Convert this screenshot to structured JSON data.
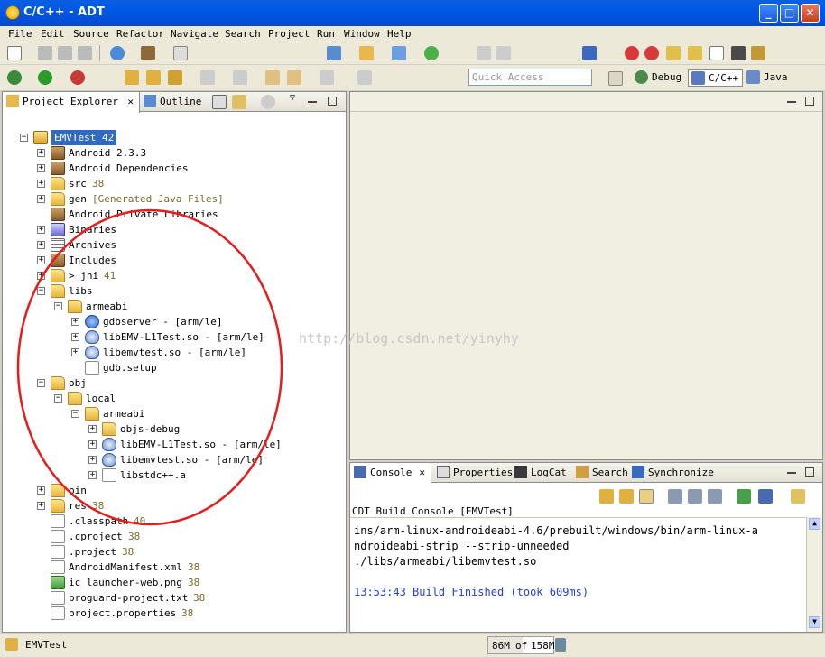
{
  "window": {
    "title": "C/C++ - ADT",
    "minimize": "_",
    "maximize": "□",
    "close": "✕"
  },
  "menu": [
    "File",
    "Edit",
    "Source",
    "Refactor",
    "Navigate",
    "Search",
    "Project",
    "Run",
    "Window",
    "Help"
  ],
  "quick_access": {
    "placeholder": "Quick Access"
  },
  "perspectives": [
    {
      "label": "Debug"
    },
    {
      "label": "C/C++",
      "active": true
    },
    {
      "label": "Java"
    }
  ],
  "left_panel": {
    "tabs": [
      {
        "label": "Project Explorer",
        "close": "✕"
      },
      {
        "label": "Outline"
      }
    ],
    "tree": [
      {
        "label": "EMVTest 42",
        "selected": true,
        "icon": "project-icon",
        "depth": 0,
        "expander": "minus"
      },
      {
        "label": "Android 2.3.3",
        "icon": "library-icon",
        "depth": 1,
        "expander": "plus"
      },
      {
        "label": "Android Dependencies",
        "icon": "library-icon",
        "depth": 1,
        "expander": "plus"
      },
      {
        "label": "src",
        "decoration": "38",
        "icon": "source-folder-icon",
        "depth": 1,
        "expander": "plus"
      },
      {
        "label": "gen",
        "decoration": "[Generated Java Files]",
        "icon": "source-folder-icon",
        "depth": 1,
        "expander": "plus"
      },
      {
        "label": "Android Private Libraries",
        "icon": "library-icon",
        "depth": 1,
        "expander": "none"
      },
      {
        "label": "Binaries",
        "icon": "binaries-icon",
        "depth": 1,
        "expander": "plus"
      },
      {
        "label": "Archives",
        "icon": "archives-icon",
        "depth": 1,
        "expander": "plus"
      },
      {
        "label": "Includes",
        "icon": "includes-icon",
        "depth": 1,
        "expander": "plus"
      },
      {
        "label": "> jni",
        "decoration": "41",
        "icon": "folder-icon",
        "depth": 1,
        "expander": "plus"
      },
      {
        "label": "libs",
        "icon": "folder-icon",
        "depth": 1,
        "expander": "minus"
      },
      {
        "label": "armeabi",
        "icon": "folder-icon",
        "depth": 2,
        "expander": "minus"
      },
      {
        "label": "gdbserver - [arm/le]",
        "icon": "executable-icon",
        "depth": 3,
        "expander": "plus"
      },
      {
        "label": "libEMV-L1Test.so - [arm/le]",
        "icon": "shared-object-icon",
        "depth": 3,
        "expander": "plus"
      },
      {
        "label": "libemvtest.so - [arm/le]",
        "icon": "shared-object-icon",
        "depth": 3,
        "expander": "plus"
      },
      {
        "label": "gdb.setup",
        "icon": "file-icon",
        "depth": 3,
        "expander": "none"
      },
      {
        "label": "obj",
        "icon": "folder-icon",
        "depth": 1,
        "expander": "minus"
      },
      {
        "label": "local",
        "icon": "folder-icon",
        "depth": 2,
        "expander": "minus"
      },
      {
        "label": "armeabi",
        "icon": "folder-icon",
        "depth": 3,
        "expander": "minus"
      },
      {
        "label": "objs-debug",
        "icon": "folder-icon",
        "depth": 4,
        "expander": "plus"
      },
      {
        "label": "libEMV-L1Test.so - [arm/le]",
        "icon": "shared-object-icon",
        "depth": 4,
        "expander": "plus"
      },
      {
        "label": "libemvtest.so - [arm/le]",
        "icon": "shared-object-icon",
        "depth": 4,
        "expander": "plus"
      },
      {
        "label": "libstdc++.a",
        "icon": "archive-file-icon",
        "depth": 4,
        "expander": "plus"
      },
      {
        "label": "bin",
        "icon": "folder-icon",
        "depth": 1,
        "expander": "plus"
      },
      {
        "label": "res",
        "decoration": "38",
        "icon": "folder-icon",
        "depth": 1,
        "expander": "plus"
      },
      {
        "label": ".classpath",
        "decoration": "40",
        "icon": "xml-file-icon",
        "depth": 1,
        "expander": "none"
      },
      {
        "label": ".cproject",
        "decoration": "38",
        "icon": "xml-file-icon",
        "depth": 1,
        "expander": "none"
      },
      {
        "label": ".project",
        "decoration": "38",
        "icon": "xml-file-icon",
        "depth": 1,
        "expander": "none"
      },
      {
        "label": "AndroidManifest.xml",
        "decoration": "38",
        "icon": "manifest-icon",
        "depth": 1,
        "expander": "none"
      },
      {
        "label": "ic_launcher-web.png",
        "decoration": "38",
        "icon": "image-file-icon",
        "depth": 1,
        "expander": "none"
      },
      {
        "label": "proguard-project.txt",
        "decoration": "38",
        "icon": "text-file-icon",
        "depth": 1,
        "expander": "none"
      },
      {
        "label": "project.properties",
        "decoration": "38",
        "icon": "text-file-icon",
        "depth": 1,
        "expander": "none"
      }
    ]
  },
  "bottom_panel": {
    "tabs": [
      {
        "label": "Console",
        "close": "✕"
      },
      {
        "label": "Properties"
      },
      {
        "label": "LogCat"
      },
      {
        "label": "Search"
      },
      {
        "label": "Synchronize"
      }
    ],
    "console_title": "CDT Build Console [EMVTest]",
    "lines": [
      "ins/arm-linux-androideabi-4.6/prebuilt/windows/bin/arm-linux-a",
      "ndroideabi-strip --strip-unneeded",
      "./libs/armeabi/libemvtest.so",
      "",
      "13:53:43 Build Finished (took 609ms)"
    ],
    "finished_color": "#2a40c8"
  },
  "watermark": "http://blog.csdn.net/yinyhy",
  "status_bar": {
    "selection": "EMVTest",
    "heap_used": "86M",
    "heap_of": "of",
    "heap_total": "158M"
  },
  "colors": {
    "title_bar": "#0058e6",
    "selection": "#316ac5",
    "annotation_circle": "#e81c1c"
  }
}
